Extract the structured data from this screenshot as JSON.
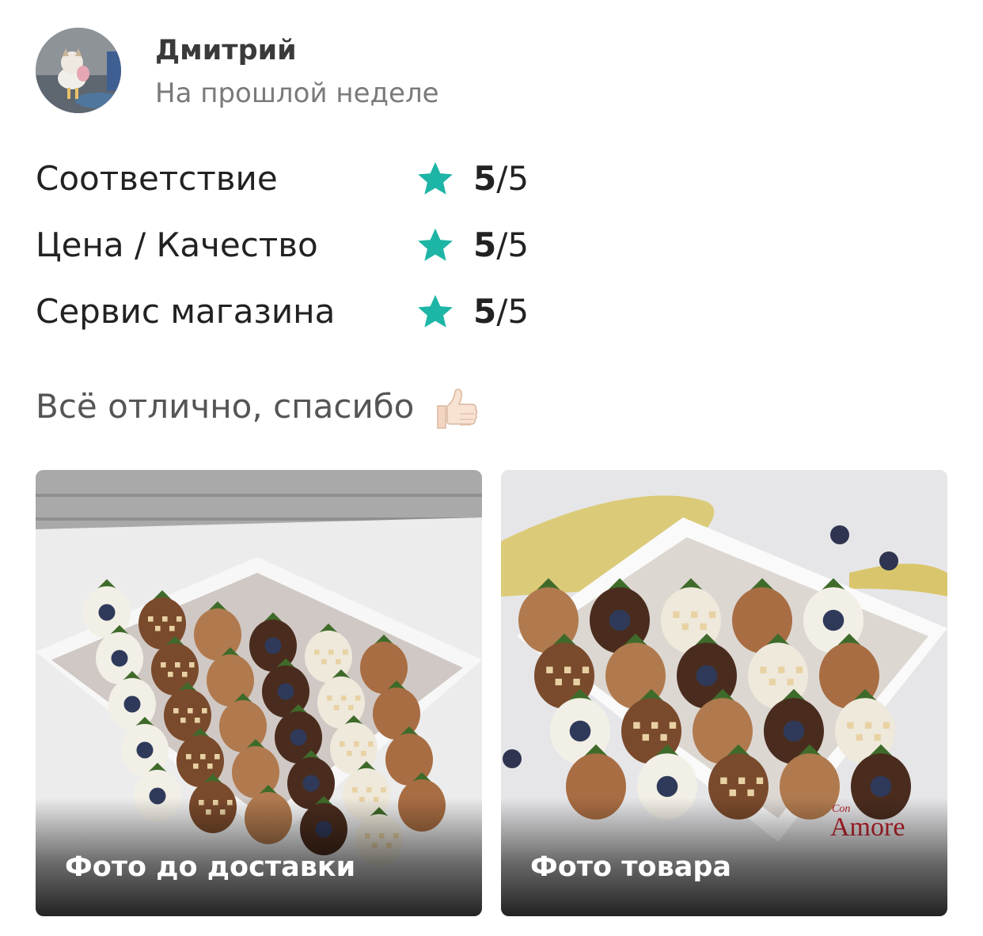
{
  "review": {
    "author": {
      "name": "Дмитрий",
      "date": "На прошлой неделе"
    },
    "ratings": [
      {
        "label": "Соответствие",
        "score": "5",
        "max": "/5"
      },
      {
        "label": "Цена / Качество",
        "score": "5",
        "max": "/5"
      },
      {
        "label": "Сервис магазина",
        "score": "5",
        "max": "/5"
      }
    ],
    "text": "Всё отлично, спасибо",
    "emoji_icon": "thumbs-up-icon",
    "photos": [
      {
        "caption": "Фото до доставки"
      },
      {
        "caption": "Фото товара",
        "brand_watermark": "Con Amore"
      }
    ]
  },
  "colors": {
    "star": "#1db5a5",
    "author_name": "#3a3a3a",
    "secondary_text": "#7a7a7a",
    "body_text": "#222222"
  }
}
